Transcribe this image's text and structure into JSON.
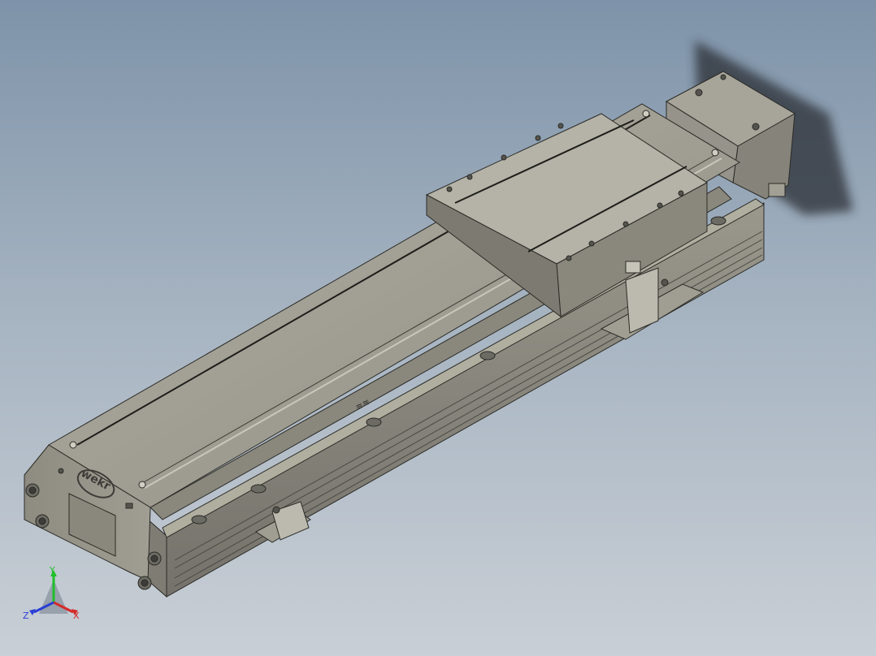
{
  "viewport": {
    "background_top": "#7e93a9",
    "background_bottom": "#c9cfd6"
  },
  "model": {
    "logo_text": "wekr",
    "body_color": "#8f8d80",
    "top_color": "#a3a195",
    "edge_color": "#2b2b27"
  },
  "triad": {
    "x_label": "X",
    "y_label": "Y",
    "z_label": "Z",
    "x_color": "#d42a2a",
    "y_color": "#1fbf2a",
    "z_color": "#2a3fd4"
  }
}
